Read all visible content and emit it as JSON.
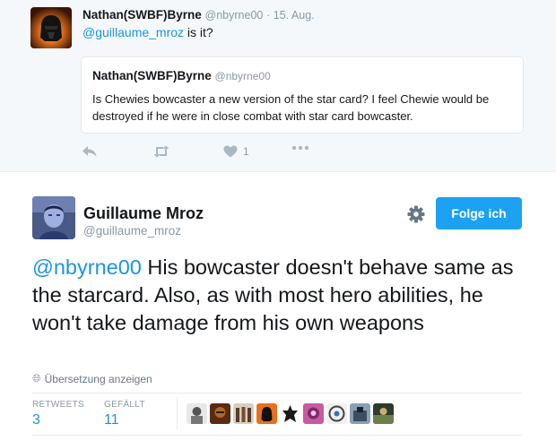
{
  "parent_tweet": {
    "name": "Nathan(SWBF)Byrne",
    "handle": "@nbyrne00",
    "date": "· 15. Aug.",
    "mention": "@guillaume_mroz",
    "text_rest": " is it?",
    "quote": {
      "name": "Nathan(SWBF)Byrne",
      "handle": "@nbyrne00",
      "text": "Is Chewies bowcaster a new version of the star card? I feel Chewie would be destroyed if he were in close combat with star card bowcaster."
    },
    "actions": {
      "reply_icon": "reply-icon",
      "retweet_icon": "retweet-icon",
      "like_icon": "heart-icon",
      "like_count": "1",
      "more_icon": "more-icon"
    }
  },
  "main_tweet": {
    "name": "Guillaume Mroz",
    "handle": "@guillaume_mroz",
    "follow_label": "Folge ich",
    "mention": "@nbyrne00",
    "text_rest": " His bowcaster doesn't behave same as the starcard. Also, as with most hero abilities, he won't take damage from his own weapons",
    "translate_label": "Übersetzung anzeigen",
    "stats": {
      "retweets_label": "RETWEETS",
      "retweets_value": "3",
      "likes_label": "GEFÄLLT",
      "likes_value": "11"
    },
    "likers_count": 10
  },
  "colors": {
    "accent": "#1da1f2",
    "link": "#1b95e0",
    "muted": "#8899a6",
    "background_parent": "#f5f8fa"
  }
}
